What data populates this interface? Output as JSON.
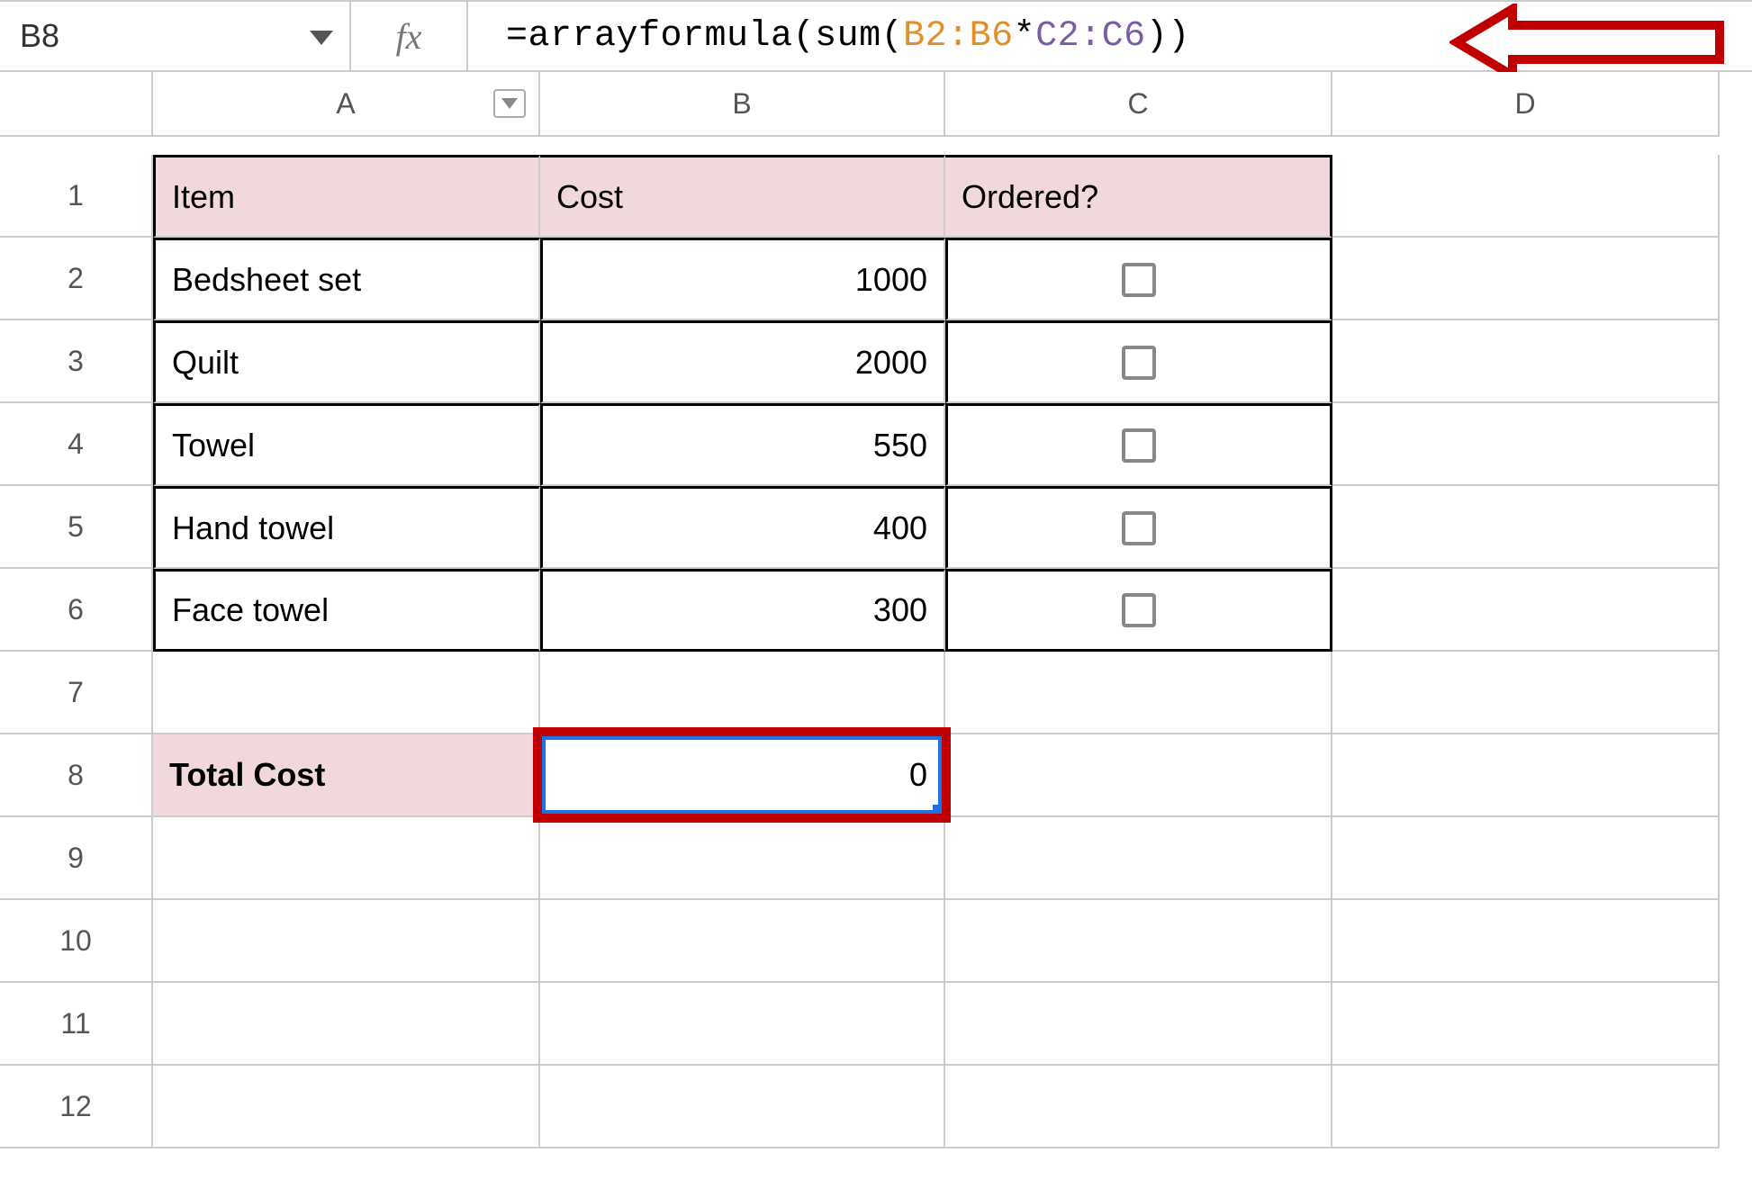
{
  "nameBox": {
    "value": "B8"
  },
  "formulaBar": {
    "eq": "=",
    "fn1": "arrayformula",
    "open1": "(",
    "fn2": "sum",
    "open2": "(",
    "ref1": "B2:B6",
    "op": "*",
    "ref2": "C2:C6",
    "close2": ")",
    "close1": ")"
  },
  "fxLabel": "fx",
  "columnHeaders": [
    "A",
    "B",
    "C",
    "D"
  ],
  "rowHeaders": [
    "1",
    "2",
    "3",
    "4",
    "5",
    "6",
    "7",
    "8",
    "9",
    "10",
    "11",
    "12"
  ],
  "headerRow": {
    "item": "Item",
    "cost": "Cost",
    "ordered": "Ordered?"
  },
  "data": [
    {
      "item": "Bedsheet set",
      "cost": "1000"
    },
    {
      "item": "Quilt",
      "cost": "2000"
    },
    {
      "item": "Towel",
      "cost": "550"
    },
    {
      "item": "Hand towel",
      "cost": "400"
    },
    {
      "item": "Face towel",
      "cost": "300"
    }
  ],
  "totalRow": {
    "label": "Total Cost",
    "value": "0"
  }
}
